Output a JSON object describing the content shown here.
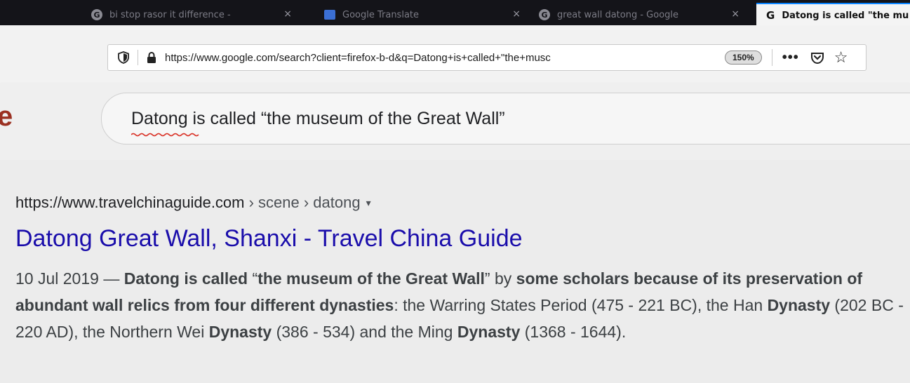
{
  "browser": {
    "tabs": [
      {
        "title": "bi stop rasor it difference -",
        "icon": "google-g-icon",
        "active": false
      },
      {
        "title": "Google Translate",
        "icon": "google-translate-icon",
        "active": false
      },
      {
        "title": "great wall datong - Google",
        "icon": "google-g-icon",
        "active": false
      },
      {
        "title": "Datong is called \"the mu",
        "icon": "google-g-icon",
        "active": true
      }
    ],
    "close_glyph": "×",
    "active_favicon_letter": "G",
    "url": "https://www.google.com/search?client=firefox-b-d&q=Datong+is+called+\"the+musc",
    "zoom": "150%",
    "page_actions": "•••",
    "star": "☆"
  },
  "search": {
    "logo_fragment": "e",
    "query": "Datong is called “the museum of the Great Wall”"
  },
  "result": {
    "cite_domain": "https://www.travelchinaguide.com",
    "cite_path": " › scene › datong",
    "dropdown": "▾",
    "title": "Datong Great Wall, Shanxi - Travel China Guide",
    "snippet": [
      {
        "text": "10 Jul 2019 — ",
        "bold": false
      },
      {
        "text": "Datong is called",
        "bold": true
      },
      {
        "text": " “",
        "bold": false
      },
      {
        "text": "the museum of the Great Wall",
        "bold": true
      },
      {
        "text": "” by ",
        "bold": false
      },
      {
        "text": "some scholars because of its preservation of abundant wall relics from four different dynasties",
        "bold": true
      },
      {
        "text": ": the Warring States Period (475 - 221 BC), the Han ",
        "bold": false
      },
      {
        "text": "Dynasty",
        "bold": true
      },
      {
        "text": " (202 BC - 220 AD), the Northern Wei ",
        "bold": false
      },
      {
        "text": "Dynasty",
        "bold": true
      },
      {
        "text": " (386 - 534) and the Ming ",
        "bold": false
      },
      {
        "text": "Dynasty",
        "bold": true
      },
      {
        "text": " (1368 - 1644).",
        "bold": false
      }
    ]
  }
}
